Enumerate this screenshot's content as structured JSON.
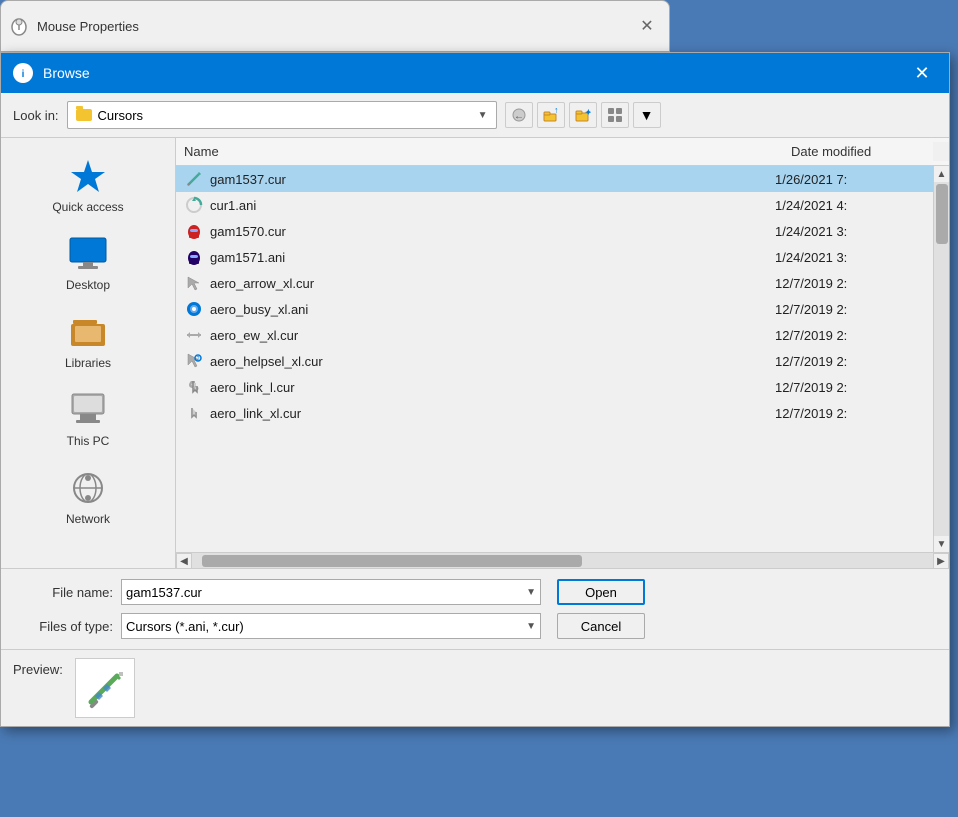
{
  "mouseProperties": {
    "title": "Mouse Properties",
    "closeBtn": "✕"
  },
  "browse": {
    "title": "Browse",
    "closeBtn": "✕",
    "titleIcon": "🖱",
    "toolbar": {
      "lookInLabel": "Look in:",
      "currentFolder": "Cursors",
      "backBtn": "←",
      "upBtn": "↑",
      "newFolderBtn": "📁",
      "viewBtn": "⊞",
      "viewDropBtn": "▼"
    },
    "fileList": {
      "columns": [
        "Name",
        "Date modified"
      ],
      "files": [
        {
          "name": "gam1537.cur",
          "date": "1/26/2021 7:",
          "icon": "⚔",
          "selected": true
        },
        {
          "name": "cur1.ani",
          "date": "1/24/2021 4:",
          "icon": "✱",
          "selected": false
        },
        {
          "name": "gam1570.cur",
          "date": "1/24/2021 3:",
          "icon": "👾",
          "selected": false
        },
        {
          "name": "gam1571.ani",
          "date": "1/24/2021 3:",
          "icon": "👾",
          "selected": false
        },
        {
          "name": "aero_arrow_xl.cur",
          "date": "12/7/2019 2:",
          "icon": "↖",
          "selected": false
        },
        {
          "name": "aero_busy_xl.ani",
          "date": "12/7/2019 2:",
          "icon": "🔵",
          "selected": false
        },
        {
          "name": "aero_ew_xl.cur",
          "date": "12/7/2019 2:",
          "icon": "↔",
          "selected": false
        },
        {
          "name": "aero_helpsel_xl.cur",
          "date": "12/7/2019 2:",
          "icon": "↗",
          "selected": false
        },
        {
          "name": "aero_link_l.cur",
          "date": "12/7/2019 2:",
          "icon": "👆",
          "selected": false
        },
        {
          "name": "aero_link_xl.cur",
          "date": "12/7/2019 2:",
          "icon": "👆",
          "selected": false
        }
      ]
    },
    "bottom": {
      "fileNameLabel": "File name:",
      "fileNameValue": "gam1537.cur",
      "filesOfTypeLabel": "Files of type:",
      "filesOfTypeValue": "Cursors (*.ani, *.cur)",
      "openBtn": "Open",
      "cancelBtn": "Cancel"
    },
    "preview": {
      "label": "Preview:",
      "icon": "⚔"
    }
  },
  "sidebar": {
    "items": [
      {
        "id": "quick-access",
        "label": "Quick access",
        "icon": "⭐"
      },
      {
        "id": "desktop",
        "label": "Desktop",
        "icon": "🖥"
      },
      {
        "id": "libraries",
        "label": "Libraries",
        "icon": "📚"
      },
      {
        "id": "this-pc",
        "label": "This PC",
        "icon": "💻"
      },
      {
        "id": "network",
        "label": "Network",
        "icon": "🌐"
      }
    ]
  }
}
